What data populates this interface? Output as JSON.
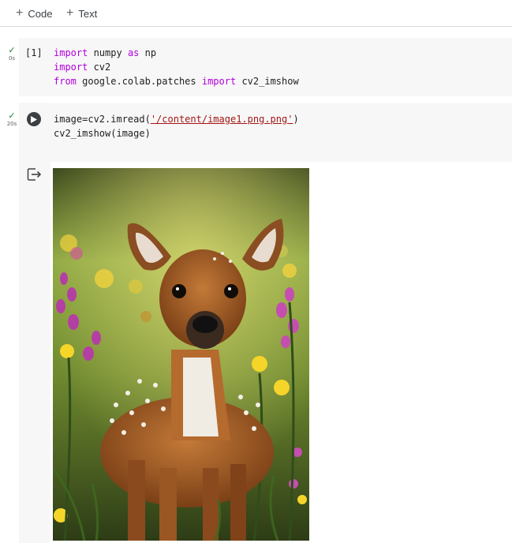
{
  "toolbar": {
    "code_label": "Code",
    "text_label": "Text"
  },
  "cells": [
    {
      "status_duration": "0s",
      "execution_count": "[1]",
      "lines": [
        [
          {
            "t": "import",
            "c": "kw"
          },
          {
            "t": " numpy ",
            "c": "plain"
          },
          {
            "t": "as",
            "c": "kw"
          },
          {
            "t": " np",
            "c": "plain"
          }
        ],
        [
          {
            "t": "import",
            "c": "kw"
          },
          {
            "t": " cv2",
            "c": "plain"
          }
        ],
        [
          {
            "t": "from",
            "c": "kw"
          },
          {
            "t": " google.colab.patches ",
            "c": "plain"
          },
          {
            "t": "import",
            "c": "kw"
          },
          {
            "t": " cv2_imshow",
            "c": "plain"
          }
        ]
      ]
    },
    {
      "status_duration": "20s",
      "lines": [
        [
          {
            "t": "image=cv2.imread(",
            "c": "plain"
          },
          {
            "t": "'/content/image1.png.png'",
            "c": "str"
          },
          {
            "t": ")",
            "c": "plain"
          }
        ],
        [
          {
            "t": "cv2_imshow(image)",
            "c": "plain"
          }
        ]
      ]
    }
  ],
  "colors": {
    "keyword": "#af00db",
    "string": "#a31515",
    "success_check": "#188038",
    "cell_background": "#f7f7f7"
  },
  "icons": {
    "check": "checkmark-icon",
    "run": "play-icon",
    "output": "output-menu-icon"
  }
}
